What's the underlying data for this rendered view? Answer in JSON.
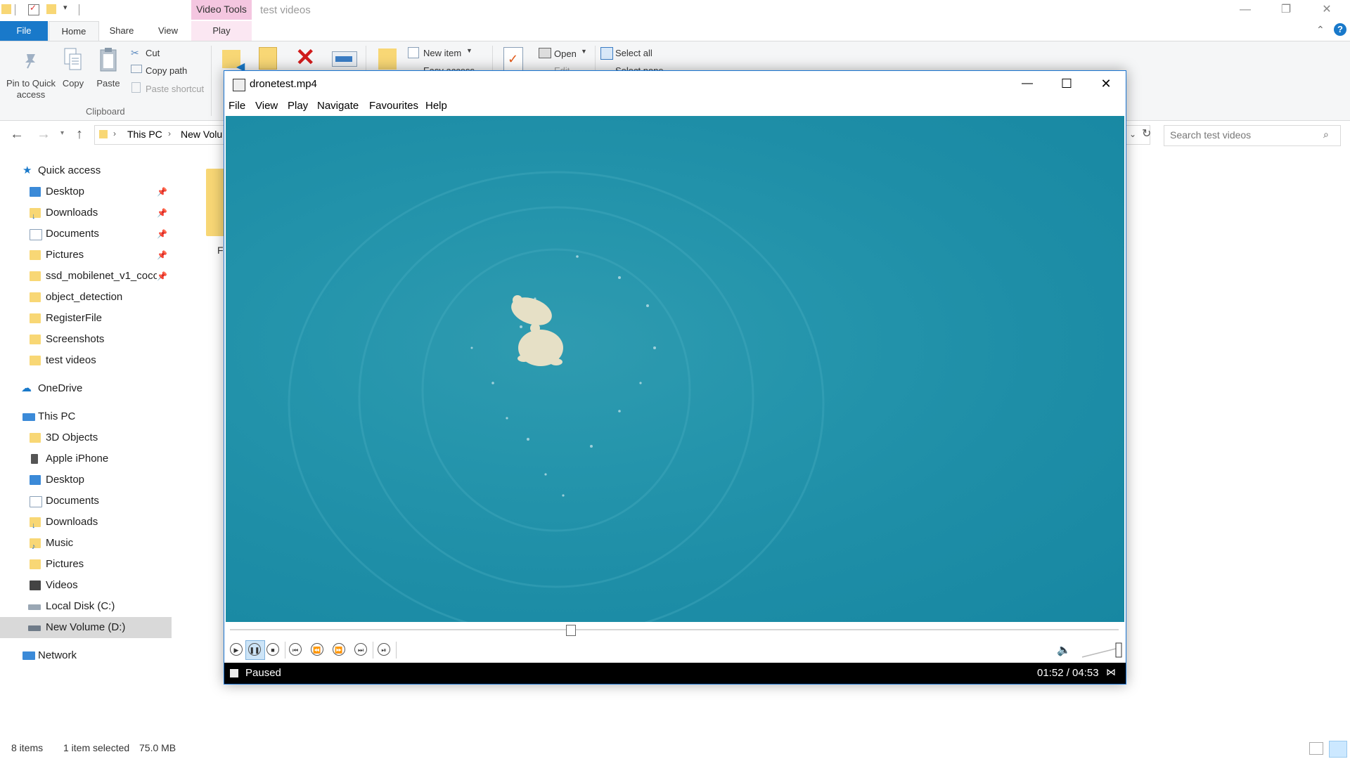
{
  "explorer": {
    "title": "test videos",
    "context_tab": "Video Tools",
    "tabs": {
      "file": "File",
      "home": "Home",
      "share": "Share",
      "view": "View",
      "play": "Play"
    },
    "ribbon": {
      "pin_label_1": "Pin to Quick",
      "pin_label_2": "access",
      "copy": "Copy",
      "paste": "Paste",
      "cut": "Cut",
      "copy_path": "Copy path",
      "paste_shortcut": "Paste shortcut",
      "clipboard_group": "Clipboard",
      "new_item": "New item",
      "easy_access": "Easy access",
      "open": "Open",
      "edit": "Edit",
      "select_all": "Select all",
      "select_none": "Select none"
    },
    "breadcrumb": {
      "this_pc": "This PC",
      "volume": "New Volu"
    },
    "search_placeholder": "Search test videos",
    "nav": {
      "quick_access": "Quick access",
      "quick_items": [
        "Desktop",
        "Downloads",
        "Documents",
        "Pictures",
        "ssd_mobilenet_v1_coco_",
        "object_detection",
        "RegisterFile",
        "Screenshots",
        "test videos"
      ],
      "onedrive": "OneDrive",
      "this_pc": "This PC",
      "pc_items": [
        "3D Objects",
        "Apple iPhone",
        "Desktop",
        "Documents",
        "Downloads",
        "Music",
        "Pictures",
        "Videos",
        "Local Disk (C:)",
        "New Volume (D:)"
      ],
      "network": "Network"
    },
    "partial_file_label": "Fr",
    "status": {
      "count": "8 items",
      "selected": "1 item selected",
      "size": "75.0 MB"
    }
  },
  "player": {
    "title": "dronetest.mp4",
    "menu": [
      "File",
      "View",
      "Play",
      "Navigate",
      "Favourites",
      "Help"
    ],
    "status": "Paused",
    "time": "01:52 / 04:53",
    "seek_position": 0.383,
    "volume_level": 1.0
  },
  "colors": {
    "accent": "#1979ca",
    "context_tab": "#f4c6e0",
    "water": "#1f8fa8",
    "status_bg": "#000000"
  }
}
